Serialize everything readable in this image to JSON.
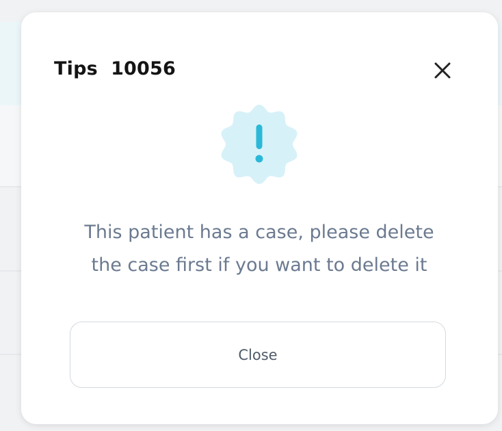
{
  "dialog": {
    "title": "Tips  10056",
    "message_line1": "This patient has a case, please delete",
    "message_line2": "the case first if you want to delete it",
    "close_button_label": "Close",
    "close_icon": "close-icon",
    "alert_icon": "exclamation-badge-icon"
  },
  "colors": {
    "badge_fill": "#d7f1f8",
    "badge_mark": "#2bb8d8",
    "message_text": "#6b7a90"
  }
}
